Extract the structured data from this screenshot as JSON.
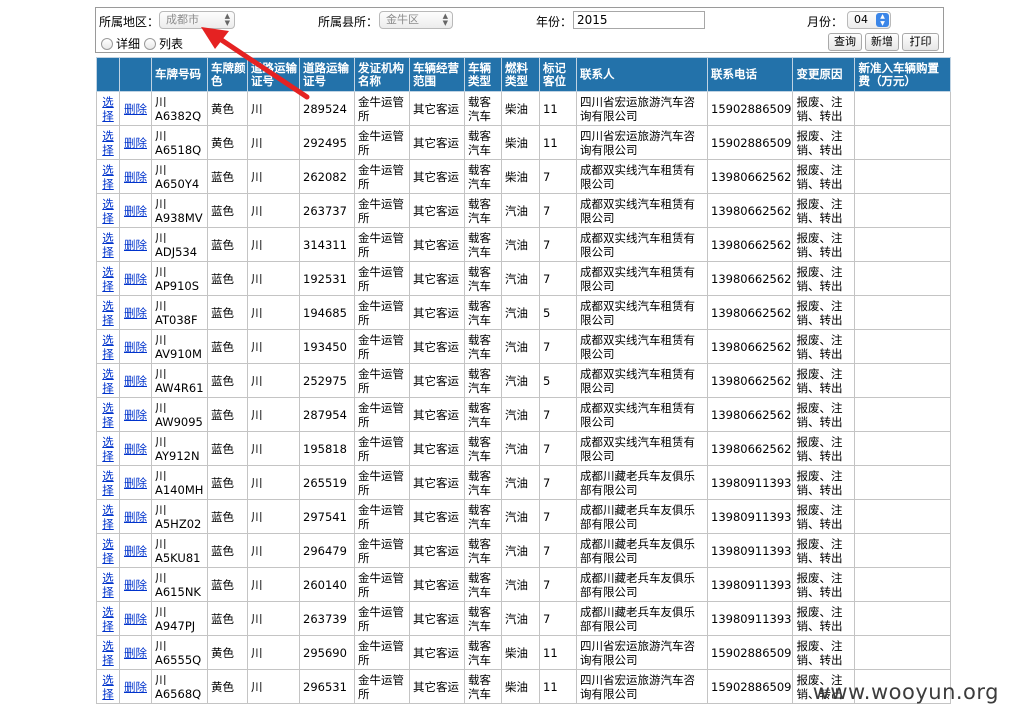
{
  "filter": {
    "region_label": "所属地区：",
    "region_value": "成都市",
    "county_label": "所属县所：",
    "county_value": "金牛区",
    "year_label": "年份：",
    "year_value": "2015",
    "month_label": "月份：",
    "month_value": "04",
    "view_detail": "详细",
    "view_list": "列表",
    "query_btn": "查询",
    "add_btn": "新增",
    "print_btn": "打印"
  },
  "table": {
    "headers": [
      "",
      "",
      "车牌号码",
      "车牌颜色",
      "道路运输证号",
      "道路运输证号",
      "发证机构名称",
      "车辆经营范围",
      "车辆类型",
      "燃料类型",
      "标记客位",
      "联系人",
      "联系电话",
      "变更原因",
      "新准入车辆购置费（万元）"
    ],
    "select_label": "选择",
    "delete_label": "删除",
    "rows": [
      {
        "plate": "川A6382Q",
        "color": "黄色",
        "cert_a": "川",
        "cert_b": "289524",
        "org": "金牛运管所",
        "scope": "其它客运",
        "vtype": "载客汽车",
        "fuel": "柴油",
        "seats": "11",
        "contact": "四川省宏运旅游汽车咨询有限公司",
        "phone": "15902886509",
        "reason": "报废、注销、转出",
        "fee": ""
      },
      {
        "plate": "川A6518Q",
        "color": "黄色",
        "cert_a": "川",
        "cert_b": "292495",
        "org": "金牛运管所",
        "scope": "其它客运",
        "vtype": "载客汽车",
        "fuel": "柴油",
        "seats": "11",
        "contact": "四川省宏运旅游汽车咨询有限公司",
        "phone": "15902886509",
        "reason": "报废、注销、转出",
        "fee": ""
      },
      {
        "plate": "川A650Y4",
        "color": "蓝色",
        "cert_a": "川",
        "cert_b": "262082",
        "org": "金牛运管所",
        "scope": "其它客运",
        "vtype": "载客汽车",
        "fuel": "柴油",
        "seats": "7",
        "contact": "成都双实线汽车租赁有限公司",
        "phone": "13980662562",
        "reason": "报废、注销、转出",
        "fee": ""
      },
      {
        "plate": "川A938MV",
        "color": "蓝色",
        "cert_a": "川",
        "cert_b": "263737",
        "org": "金牛运管所",
        "scope": "其它客运",
        "vtype": "载客汽车",
        "fuel": "汽油",
        "seats": "7",
        "contact": "成都双实线汽车租赁有限公司",
        "phone": "13980662562",
        "reason": "报废、注销、转出",
        "fee": ""
      },
      {
        "plate": "川ADJ534",
        "color": "蓝色",
        "cert_a": "川",
        "cert_b": "314311",
        "org": "金牛运管所",
        "scope": "其它客运",
        "vtype": "载客汽车",
        "fuel": "汽油",
        "seats": "7",
        "contact": "成都双实线汽车租赁有限公司",
        "phone": "13980662562",
        "reason": "报废、注销、转出",
        "fee": ""
      },
      {
        "plate": "川AP910S",
        "color": "蓝色",
        "cert_a": "川",
        "cert_b": "192531",
        "org": "金牛运管所",
        "scope": "其它客运",
        "vtype": "载客汽车",
        "fuel": "汽油",
        "seats": "7",
        "contact": "成都双实线汽车租赁有限公司",
        "phone": "13980662562",
        "reason": "报废、注销、转出",
        "fee": ""
      },
      {
        "plate": "川AT038F",
        "color": "蓝色",
        "cert_a": "川",
        "cert_b": "194685",
        "org": "金牛运管所",
        "scope": "其它客运",
        "vtype": "载客汽车",
        "fuel": "汽油",
        "seats": "5",
        "contact": "成都双实线汽车租赁有限公司",
        "phone": "13980662562",
        "reason": "报废、注销、转出",
        "fee": ""
      },
      {
        "plate": "川AV910M",
        "color": "蓝色",
        "cert_a": "川",
        "cert_b": "193450",
        "org": "金牛运管所",
        "scope": "其它客运",
        "vtype": "载客汽车",
        "fuel": "汽油",
        "seats": "7",
        "contact": "成都双实线汽车租赁有限公司",
        "phone": "13980662562",
        "reason": "报废、注销、转出",
        "fee": ""
      },
      {
        "plate": "川AW4R61",
        "color": "蓝色",
        "cert_a": "川",
        "cert_b": "252975",
        "org": "金牛运管所",
        "scope": "其它客运",
        "vtype": "载客汽车",
        "fuel": "汽油",
        "seats": "5",
        "contact": "成都双实线汽车租赁有限公司",
        "phone": "13980662562",
        "reason": "报废、注销、转出",
        "fee": ""
      },
      {
        "plate": "川AW9095",
        "color": "蓝色",
        "cert_a": "川",
        "cert_b": "287954",
        "org": "金牛运管所",
        "scope": "其它客运",
        "vtype": "载客汽车",
        "fuel": "汽油",
        "seats": "7",
        "contact": "成都双实线汽车租赁有限公司",
        "phone": "13980662562",
        "reason": "报废、注销、转出",
        "fee": ""
      },
      {
        "plate": "川AY912N",
        "color": "蓝色",
        "cert_a": "川",
        "cert_b": "195818",
        "org": "金牛运管所",
        "scope": "其它客运",
        "vtype": "载客汽车",
        "fuel": "汽油",
        "seats": "7",
        "contact": "成都双实线汽车租赁有限公司",
        "phone": "13980662562",
        "reason": "报废、注销、转出",
        "fee": ""
      },
      {
        "plate": "川A140MH",
        "color": "蓝色",
        "cert_a": "川",
        "cert_b": "265519",
        "org": "金牛运管所",
        "scope": "其它客运",
        "vtype": "载客汽车",
        "fuel": "汽油",
        "seats": "7",
        "contact": "成都川藏老兵车友俱乐部有限公司",
        "phone": "13980911393",
        "reason": "报废、注销、转出",
        "fee": ""
      },
      {
        "plate": "川A5HZ02",
        "color": "蓝色",
        "cert_a": "川",
        "cert_b": "297541",
        "org": "金牛运管所",
        "scope": "其它客运",
        "vtype": "载客汽车",
        "fuel": "汽油",
        "seats": "7",
        "contact": "成都川藏老兵车友俱乐部有限公司",
        "phone": "13980911393",
        "reason": "报废、注销、转出",
        "fee": ""
      },
      {
        "plate": "川A5KU81",
        "color": "蓝色",
        "cert_a": "川",
        "cert_b": "296479",
        "org": "金牛运管所",
        "scope": "其它客运",
        "vtype": "载客汽车",
        "fuel": "汽油",
        "seats": "7",
        "contact": "成都川藏老兵车友俱乐部有限公司",
        "phone": "13980911393",
        "reason": "报废、注销、转出",
        "fee": ""
      },
      {
        "plate": "川A615NK",
        "color": "蓝色",
        "cert_a": "川",
        "cert_b": "260140",
        "org": "金牛运管所",
        "scope": "其它客运",
        "vtype": "载客汽车",
        "fuel": "汽油",
        "seats": "7",
        "contact": "成都川藏老兵车友俱乐部有限公司",
        "phone": "13980911393",
        "reason": "报废、注销、转出",
        "fee": ""
      },
      {
        "plate": "川A947PJ",
        "color": "蓝色",
        "cert_a": "川",
        "cert_b": "263739",
        "org": "金牛运管所",
        "scope": "其它客运",
        "vtype": "载客汽车",
        "fuel": "汽油",
        "seats": "7",
        "contact": "成都川藏老兵车友俱乐部有限公司",
        "phone": "13980911393",
        "reason": "报废、注销、转出",
        "fee": ""
      },
      {
        "plate": "川A6555Q",
        "color": "黄色",
        "cert_a": "川",
        "cert_b": "295690",
        "org": "金牛运管所",
        "scope": "其它客运",
        "vtype": "载客汽车",
        "fuel": "柴油",
        "seats": "11",
        "contact": "四川省宏运旅游汽车咨询有限公司",
        "phone": "15902886509",
        "reason": "报废、注销、转出",
        "fee": ""
      },
      {
        "plate": "川A6568Q",
        "color": "黄色",
        "cert_a": "川",
        "cert_b": "296531",
        "org": "金牛运管所",
        "scope": "其它客运",
        "vtype": "载客汽车",
        "fuel": "柴油",
        "seats": "11",
        "contact": "四川省宏运旅游汽车咨询有限公司",
        "phone": "15902886509",
        "reason": "报废、注销、转出",
        "fee": ""
      }
    ]
  },
  "watermark": "www.wooyun.org",
  "colors": {
    "header_bg": "#2372aa",
    "link": "#0033cc",
    "arrow": "#e52222"
  }
}
